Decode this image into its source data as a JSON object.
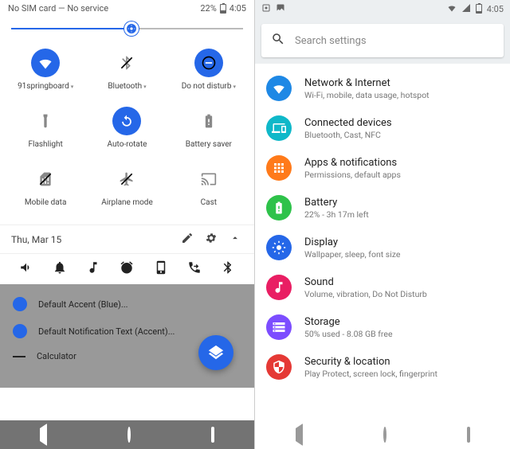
{
  "left": {
    "status": {
      "carrier": "No SIM card — No service",
      "battery_pct": "22%",
      "time": "4:05"
    },
    "brightness_pct": 52,
    "tiles": [
      {
        "label": "91springboard",
        "on": true,
        "icon": "wifi",
        "expandable": true
      },
      {
        "label": "Bluetooth",
        "on": false,
        "icon": "bluetooth",
        "expandable": true,
        "strike": true
      },
      {
        "label": "Do not disturb",
        "on": true,
        "icon": "dnd",
        "expandable": true
      },
      {
        "label": "Flashlight",
        "on": false,
        "icon": "flashlight"
      },
      {
        "label": "Auto-rotate",
        "on": true,
        "icon": "rotate"
      },
      {
        "label": "Battery saver",
        "on": false,
        "icon": "battery"
      },
      {
        "label": "Mobile data",
        "on": false,
        "icon": "sim",
        "strike": true
      },
      {
        "label": "Airplane mode",
        "on": false,
        "icon": "airplane",
        "strike": true
      },
      {
        "label": "Cast",
        "on": false,
        "icon": "cast"
      }
    ],
    "date": "Thu, Mar 15",
    "dimmed_rows": [
      "Default Accent (Blue)...",
      "Default Notification Text (Accent)...",
      "Calculator"
    ]
  },
  "right": {
    "status": {
      "time": "4:05"
    },
    "search_placeholder": "Search settings",
    "items": [
      {
        "title": "Network & Internet",
        "sub": "Wi-Fi, mobile, data usage, hotspot",
        "color": "c-blue",
        "icon": "wifi"
      },
      {
        "title": "Connected devices",
        "sub": "Bluetooth, Cast, NFC",
        "color": "c-teal",
        "icon": "devices"
      },
      {
        "title": "Apps & notifications",
        "sub": "Permissions, default apps",
        "color": "c-orange",
        "icon": "apps"
      },
      {
        "title": "Battery",
        "sub": "22% - 3h 17m left",
        "color": "c-green",
        "icon": "battery"
      },
      {
        "title": "Display",
        "sub": "Wallpaper, sleep, font size",
        "color": "c-blued",
        "icon": "brightness"
      },
      {
        "title": "Sound",
        "sub": "Volume, vibration, Do Not Disturb",
        "color": "c-pink",
        "icon": "sound"
      },
      {
        "title": "Storage",
        "sub": "50% used - 8.08 GB free",
        "color": "c-purple",
        "icon": "storage"
      },
      {
        "title": "Security & location",
        "sub": "Play Protect, screen lock, fingerprint",
        "color": "c-red",
        "icon": "security"
      }
    ]
  }
}
